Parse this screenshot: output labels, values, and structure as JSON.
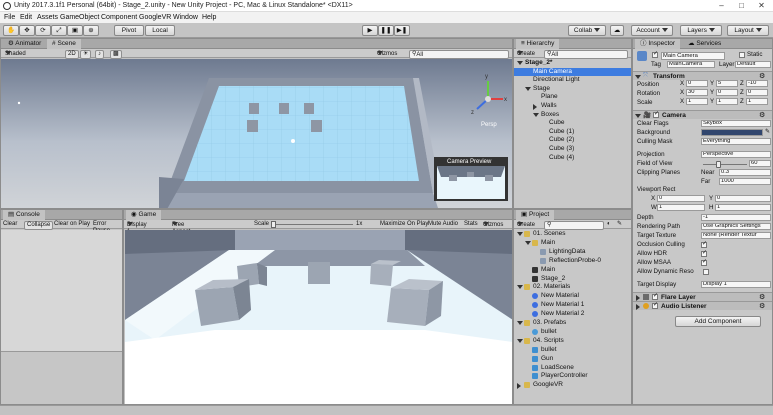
{
  "window": {
    "title": "Unity 2017.3.1f1 Personal (64bit) - Stage_2.unity - New Unity Project - PC, Mac & Linux Standalone* <DX11>"
  },
  "menu": [
    "File",
    "Edit",
    "Assets",
    "GameObject",
    "Component",
    "GoogleVR",
    "Window",
    "Help"
  ],
  "toolbar": {
    "pivot": "Pivot",
    "local": "Local",
    "collab": "Collab",
    "account": "Account",
    "layers": "Layers",
    "layout": "Layout"
  },
  "scene_panel": {
    "tab_animator": "Animator",
    "tab_scene": "Scene",
    "shaded": "Shaded",
    "twod": "2D",
    "gizmos": "Gizmos",
    "search_placeholder": "All",
    "persp": "Persp",
    "camera_preview": "Camera Preview",
    "axis": {
      "x": "x",
      "y": "y",
      "z": "z"
    }
  },
  "hierarchy": {
    "tab": "Hierarchy",
    "create": "Create",
    "search_placeholder": "All",
    "items": [
      {
        "label": "Stage_2*",
        "depth": 0,
        "arrow": "down",
        "bold": true
      },
      {
        "label": "Main Camera",
        "depth": 1,
        "selected": true
      },
      {
        "label": "Directional Light",
        "depth": 1
      },
      {
        "label": "Stage",
        "depth": 1,
        "arrow": "down"
      },
      {
        "label": "Plane",
        "depth": 2
      },
      {
        "label": "Walls",
        "depth": 2,
        "arrow": "right"
      },
      {
        "label": "Boxes",
        "depth": 2,
        "arrow": "down"
      },
      {
        "label": "Cube",
        "depth": 3
      },
      {
        "label": "Cube (1)",
        "depth": 3
      },
      {
        "label": "Cube (2)",
        "depth": 3
      },
      {
        "label": "Cube (3)",
        "depth": 3
      },
      {
        "label": "Cube (4)",
        "depth": 3
      }
    ]
  },
  "console": {
    "tab": "Console",
    "clear": "Clear",
    "collapse": "Collapse",
    "clear_on_play": "Clear on Play",
    "error_pause": "Error Pause"
  },
  "game_panel": {
    "tab": "Game",
    "display": "Display 1",
    "aspect": "Free Aspect",
    "scale_label": "Scale",
    "scale_value": "1x",
    "maximize": "Maximize On Play",
    "mute": "Mute Audio",
    "stats": "Stats",
    "gizmos": "Gizmos"
  },
  "project": {
    "tab": "Project",
    "create": "Create",
    "items": [
      {
        "label": "01. Scenes",
        "depth": 0,
        "type": "folder-open"
      },
      {
        "label": "Main",
        "depth": 1,
        "type": "folder-open"
      },
      {
        "label": "LightingData",
        "depth": 2,
        "type": "asset"
      },
      {
        "label": "ReflectionProbe-0",
        "depth": 2,
        "type": "asset"
      },
      {
        "label": "Main",
        "depth": 1,
        "type": "scene"
      },
      {
        "label": "Stage_2",
        "depth": 1,
        "type": "scene"
      },
      {
        "label": "02. Materials",
        "depth": 0,
        "type": "folder-open"
      },
      {
        "label": "New Material",
        "depth": 1,
        "type": "material"
      },
      {
        "label": "New Material 1",
        "depth": 1,
        "type": "material"
      },
      {
        "label": "New Material 2",
        "depth": 1,
        "type": "material"
      },
      {
        "label": "03. Prefabs",
        "depth": 0,
        "type": "folder-open"
      },
      {
        "label": "bullet",
        "depth": 1,
        "type": "prefab"
      },
      {
        "label": "04. Scripts",
        "depth": 0,
        "type": "folder-open"
      },
      {
        "label": "bullet",
        "depth": 1,
        "type": "script"
      },
      {
        "label": "Gun",
        "depth": 1,
        "type": "script"
      },
      {
        "label": "LoadScene",
        "depth": 1,
        "type": "script"
      },
      {
        "label": "PlayerController",
        "depth": 1,
        "type": "script"
      },
      {
        "label": "GoogleVR",
        "depth": 0,
        "type": "folder"
      }
    ]
  },
  "inspector": {
    "tab": "Inspector",
    "tab_services": "Services",
    "object_name": "Main Camera",
    "static": "Static",
    "tag_label": "Tag",
    "tag_value": "MainCamera",
    "layer_label": "Layer",
    "layer_value": "Default",
    "transform": {
      "title": "Transform",
      "position": {
        "label": "Position",
        "x": "0",
        "y": "5",
        "z": "-10"
      },
      "rotation": {
        "label": "Rotation",
        "x": "30",
        "y": "0",
        "z": "0"
      },
      "scale": {
        "label": "Scale",
        "x": "1",
        "y": "1",
        "z": "1"
      }
    },
    "camera": {
      "title": "Camera",
      "clear_flags": {
        "label": "Clear Flags",
        "value": "Skybox"
      },
      "background": {
        "label": "Background"
      },
      "culling_mask": {
        "label": "Culling Mask",
        "value": "Everything"
      },
      "projection": {
        "label": "Projection",
        "value": "Perspective"
      },
      "fov": {
        "label": "Field of View",
        "value": "60",
        "fraction": 0.333
      },
      "clipping": {
        "label": "Clipping Planes",
        "near_label": "Near",
        "near": "0.3",
        "far_label": "Far",
        "far": "1000"
      },
      "viewport": {
        "label": "Viewport Rect",
        "x": "0",
        "y": "0",
        "w": "1",
        "h": "1"
      },
      "depth": {
        "label": "Depth",
        "value": "-1"
      },
      "rendering_path": {
        "label": "Rendering Path",
        "value": "Use Graphics Settings"
      },
      "target_texture": {
        "label": "Target Texture",
        "value": "None (Render Textur"
      },
      "occlusion": {
        "label": "Occlusion Culling"
      },
      "hdr": {
        "label": "Allow HDR"
      },
      "msaa": {
        "label": "Allow MSAA"
      },
      "dynres": {
        "label": "Allow Dynamic Reso"
      },
      "target_display": {
        "label": "Target Display",
        "value": "Display 1"
      }
    },
    "flare_layer": "Flare Layer",
    "audio_listener": "Audio Listener",
    "add_component": "Add Component"
  },
  "colors": {
    "selection": "#3d7ce0",
    "camera_bg": "#31466e",
    "floor": "#a9dcf6",
    "wall": "#9aa3b3",
    "editor_bg": "#c2c2c2"
  }
}
